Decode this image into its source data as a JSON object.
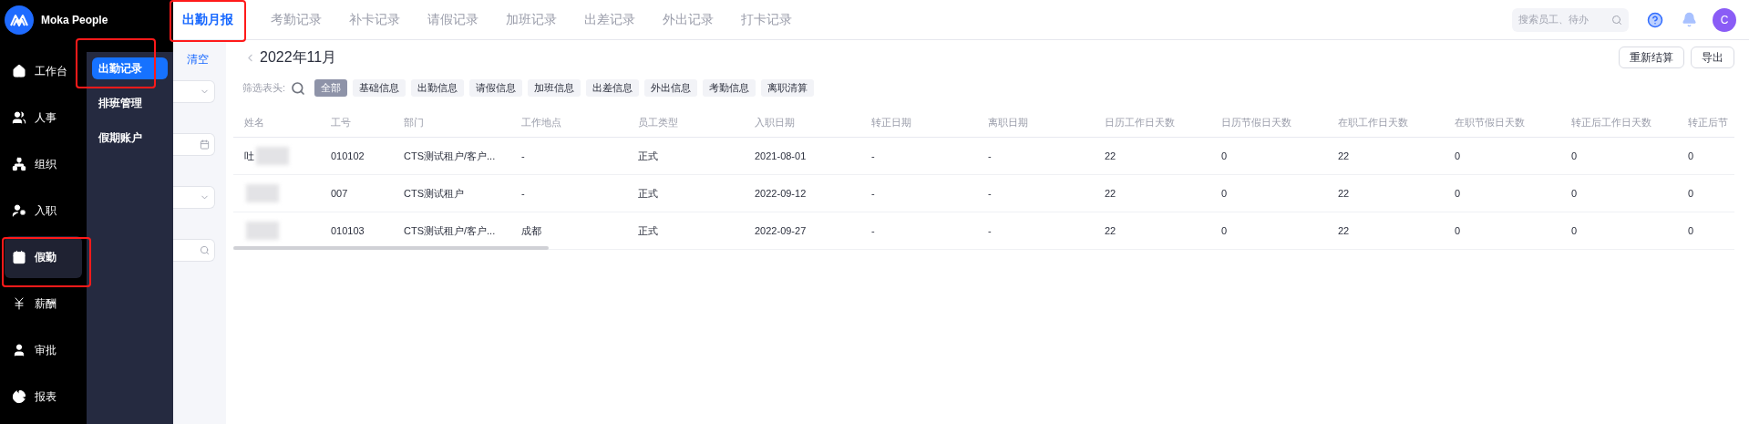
{
  "brand": "Moka People",
  "nav": [
    {
      "label": "工作台",
      "selected": false
    },
    {
      "label": "人事",
      "selected": false
    },
    {
      "label": "组织",
      "selected": false
    },
    {
      "label": "入职",
      "selected": false
    },
    {
      "label": "假勤",
      "selected": true
    },
    {
      "label": "薪酬",
      "selected": false
    },
    {
      "label": "审批",
      "selected": false
    },
    {
      "label": "报表",
      "selected": false
    }
  ],
  "subnav": [
    {
      "label": "出勤记录",
      "selected": true
    },
    {
      "label": "排班管理",
      "selected": false
    },
    {
      "label": "假期账户",
      "selected": false
    }
  ],
  "tabs": [
    {
      "label": "出勤月报",
      "selected": true
    },
    {
      "label": "考勤记录",
      "selected": false
    },
    {
      "label": "补卡记录",
      "selected": false
    },
    {
      "label": "请假记录",
      "selected": false
    },
    {
      "label": "加班记录",
      "selected": false
    },
    {
      "label": "出差记录",
      "selected": false
    },
    {
      "label": "外出记录",
      "selected": false
    },
    {
      "label": "打卡记录",
      "selected": false
    }
  ],
  "search": {
    "placeholder": "搜索员工、待办"
  },
  "avatar": "C",
  "filter_panel": {
    "clear": "清空",
    "fields": [
      {
        "kind": "select"
      },
      {
        "kind": "date"
      },
      {
        "kind": "select"
      },
      {
        "kind": "search"
      }
    ]
  },
  "period": "2022年11月",
  "actions": [
    "重新结算",
    "导出"
  ],
  "column_filter": {
    "label": "筛选表头:",
    "chips": [
      {
        "label": "全部",
        "selected": true
      },
      {
        "label": "基础信息",
        "selected": false
      },
      {
        "label": "出勤信息",
        "selected": false
      },
      {
        "label": "请假信息",
        "selected": false
      },
      {
        "label": "加班信息",
        "selected": false
      },
      {
        "label": "出差信息",
        "selected": false
      },
      {
        "label": "外出信息",
        "selected": false
      },
      {
        "label": "考勤信息",
        "selected": false
      },
      {
        "label": "离职清算",
        "selected": false
      }
    ]
  },
  "table": {
    "columns": [
      "姓名",
      "工号",
      "部门",
      "工作地点",
      "员工类型",
      "入职日期",
      "转正日期",
      "离职日期",
      "日历工作日天数",
      "日历节假日天数",
      "在职工作日天数",
      "在职节假日天数",
      "转正后工作日天数",
      "转正后节"
    ],
    "rows": [
      {
        "cells": [
          "吐",
          "010102",
          "CTS测试租户/客户...",
          "-",
          "正式",
          "2021-08-01",
          "-",
          "-",
          "22",
          "0",
          "22",
          "0",
          "0",
          "0"
        ]
      },
      {
        "cells": [
          "",
          "007",
          "CTS测试租户",
          "-",
          "正式",
          "2022-09-12",
          "-",
          "-",
          "22",
          "0",
          "22",
          "0",
          "0",
          "0"
        ]
      },
      {
        "cells": [
          "",
          "010103",
          "CTS测试租户/客户...",
          "成都",
          "正式",
          "2022-09-27",
          "-",
          "-",
          "22",
          "0",
          "22",
          "0",
          "0",
          "0"
        ]
      }
    ]
  }
}
